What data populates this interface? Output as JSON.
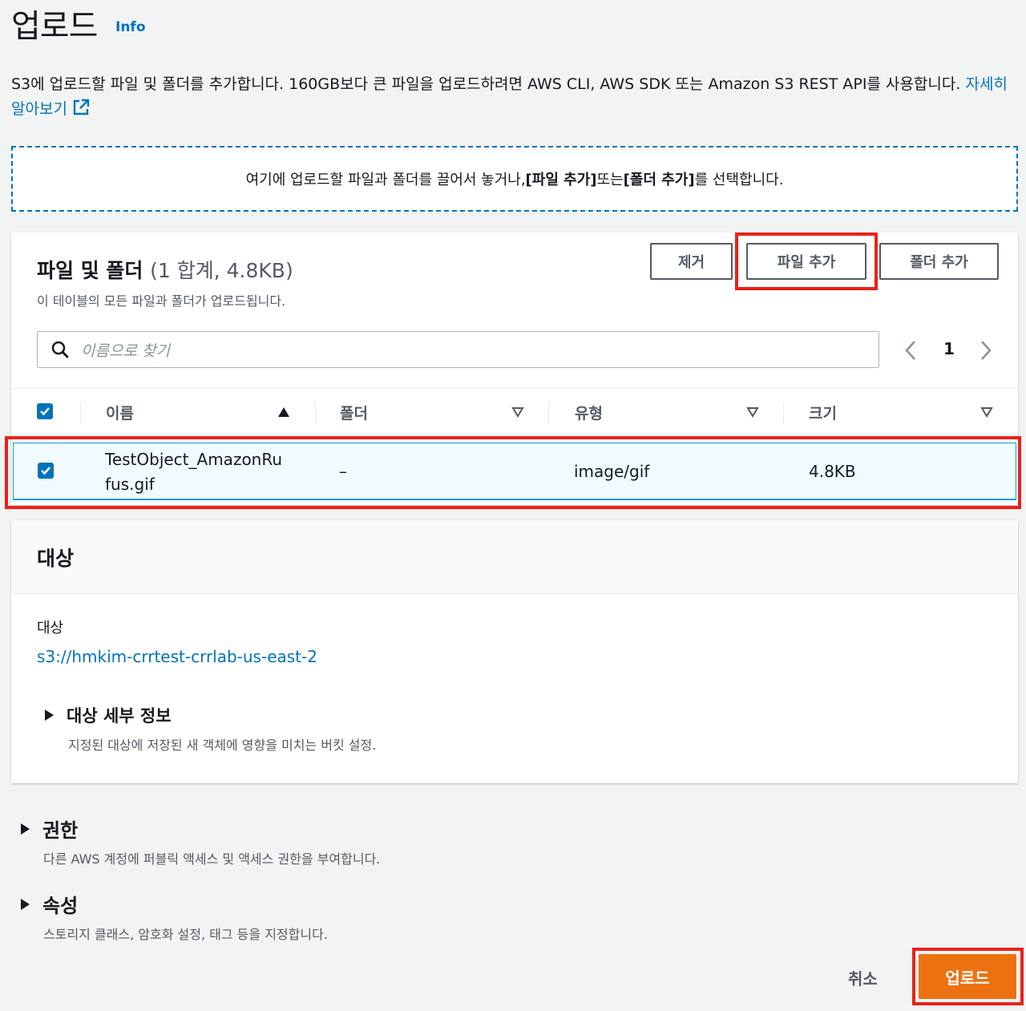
{
  "page": {
    "title": "업로드",
    "info_link": "Info",
    "description_text": "S3에 업로드할 파일 및 폴더를 추가합니다. 160GB보다 큰 파일을 업로드하려면 AWS CLI, AWS SDK 또는 Amazon S3 REST API를 사용합니다.",
    "learn_more": "자세히 알아보기"
  },
  "dropzone": {
    "text_prefix": "여기에 업로드할 파일과 폴더를 끌어서 놓거나, ",
    "add_files_bracket": "[파일 추가]",
    "text_mid": " 또는 ",
    "add_folder_bracket": "[폴더 추가]",
    "text_suffix": "를 선택합니다."
  },
  "files": {
    "title": "파일 및 폴더",
    "count": "(1 합계, 4.8KB)",
    "subtitle": "이 테이블의 모든 파일과 폴더가 업로드됩니다.",
    "remove_button": "제거",
    "add_files_button": "파일 추가",
    "add_folder_button": "폴더 추가",
    "search_placeholder": "이름으로 찾기",
    "page_number": "1",
    "columns": [
      "이름",
      "폴더",
      "유형",
      "크기"
    ],
    "rows": [
      {
        "name_line1": "TestObject_AmazonRu",
        "name_line2": "fus.gif",
        "folder": "–",
        "type": "image/gif",
        "size": "4.8KB"
      }
    ]
  },
  "destination": {
    "title": "대상",
    "label": "대상",
    "uri": "s3://hmkim-crrtest-crrlab-us-east-2",
    "details_title": "대상 세부 정보",
    "details_desc": "지정된 대상에 저장된 새 객체에 영향을 미치는 버킷 설정."
  },
  "permissions": {
    "title": "권한",
    "desc": "다른 AWS 계정에 퍼블릭 액세스 및 액세스 권한을 부여합니다."
  },
  "properties": {
    "title": "속성",
    "desc": "스토리지 클래스, 암호화 설정, 태그 등을 지정합니다."
  },
  "footer": {
    "cancel": "취소",
    "upload": "업로드"
  },
  "colors": {
    "link": "#0073bb",
    "primary_button": "#ec7211",
    "highlight": "#e8221b"
  }
}
